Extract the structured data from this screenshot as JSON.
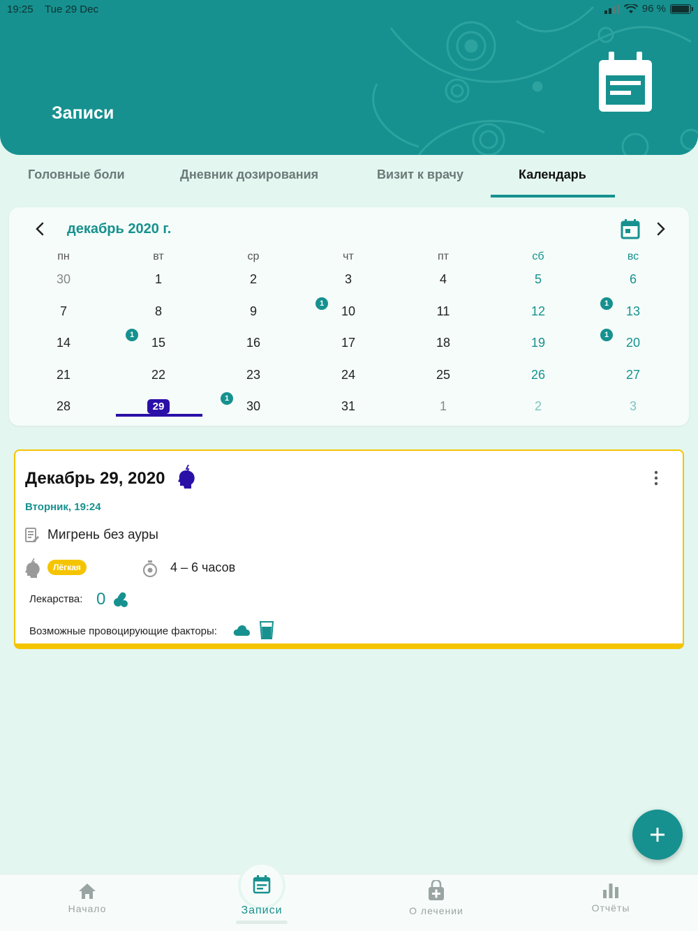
{
  "status_bar": {
    "time": "19:25",
    "date": "Tue 29 Dec",
    "battery": "96 %",
    "battery_level": 0.96
  },
  "header": {
    "title": "Записи"
  },
  "tabs": [
    {
      "label": "Головные боли"
    },
    {
      "label": "Дневник дозирования"
    },
    {
      "label": "Визит к врачу"
    },
    {
      "label": "Календарь"
    }
  ],
  "calendar": {
    "month_label": "декабрь 2020 г.",
    "weekdays": [
      "пн",
      "вт",
      "ср",
      "чт",
      "пт",
      "сб",
      "вс"
    ],
    "weeks": [
      [
        "30",
        "1",
        "2",
        "3",
        "4",
        "5",
        "6"
      ],
      [
        "7",
        "8",
        "9",
        "10",
        "11",
        "12",
        "13"
      ],
      [
        "14",
        "15",
        "16",
        "17",
        "18",
        "19",
        "20"
      ],
      [
        "21",
        "22",
        "23",
        "24",
        "25",
        "26",
        "27"
      ],
      [
        "28",
        "29",
        "30",
        "31",
        "1",
        "2",
        "3"
      ]
    ],
    "badges": [
      {
        "week": 1,
        "day": 2,
        "count": "1"
      },
      {
        "week": 1,
        "day": 5,
        "count": "1"
      },
      {
        "week": 2,
        "day": 0,
        "count": "1"
      },
      {
        "week": 2,
        "day": 5,
        "count": "1"
      },
      {
        "week": 4,
        "day": 1,
        "count": "1"
      }
    ],
    "selected": {
      "week": 4,
      "day": 1
    },
    "colors": {
      "accent": "#16918f",
      "selected": "#2b10a8"
    }
  },
  "entry": {
    "date": "Декабрь 29, 2020",
    "time": "Вторник, 19:24",
    "diagnosis": "Мигрень без ауры",
    "severity": "Лёгкая",
    "duration": "4 – 6 часов",
    "medications_label": "Лекарства:",
    "medications_count": "0",
    "triggers_label": "Возможные провоцирующие факторы:",
    "border_color": "#f5c400"
  },
  "bottom_nav": [
    {
      "label": "Начало",
      "icon": "home-icon"
    },
    {
      "label": "Записи",
      "icon": "calendar-notes-icon"
    },
    {
      "label": "О лечении",
      "icon": "medkit-icon"
    },
    {
      "label": "Отчёты",
      "icon": "bar-chart-icon"
    }
  ]
}
